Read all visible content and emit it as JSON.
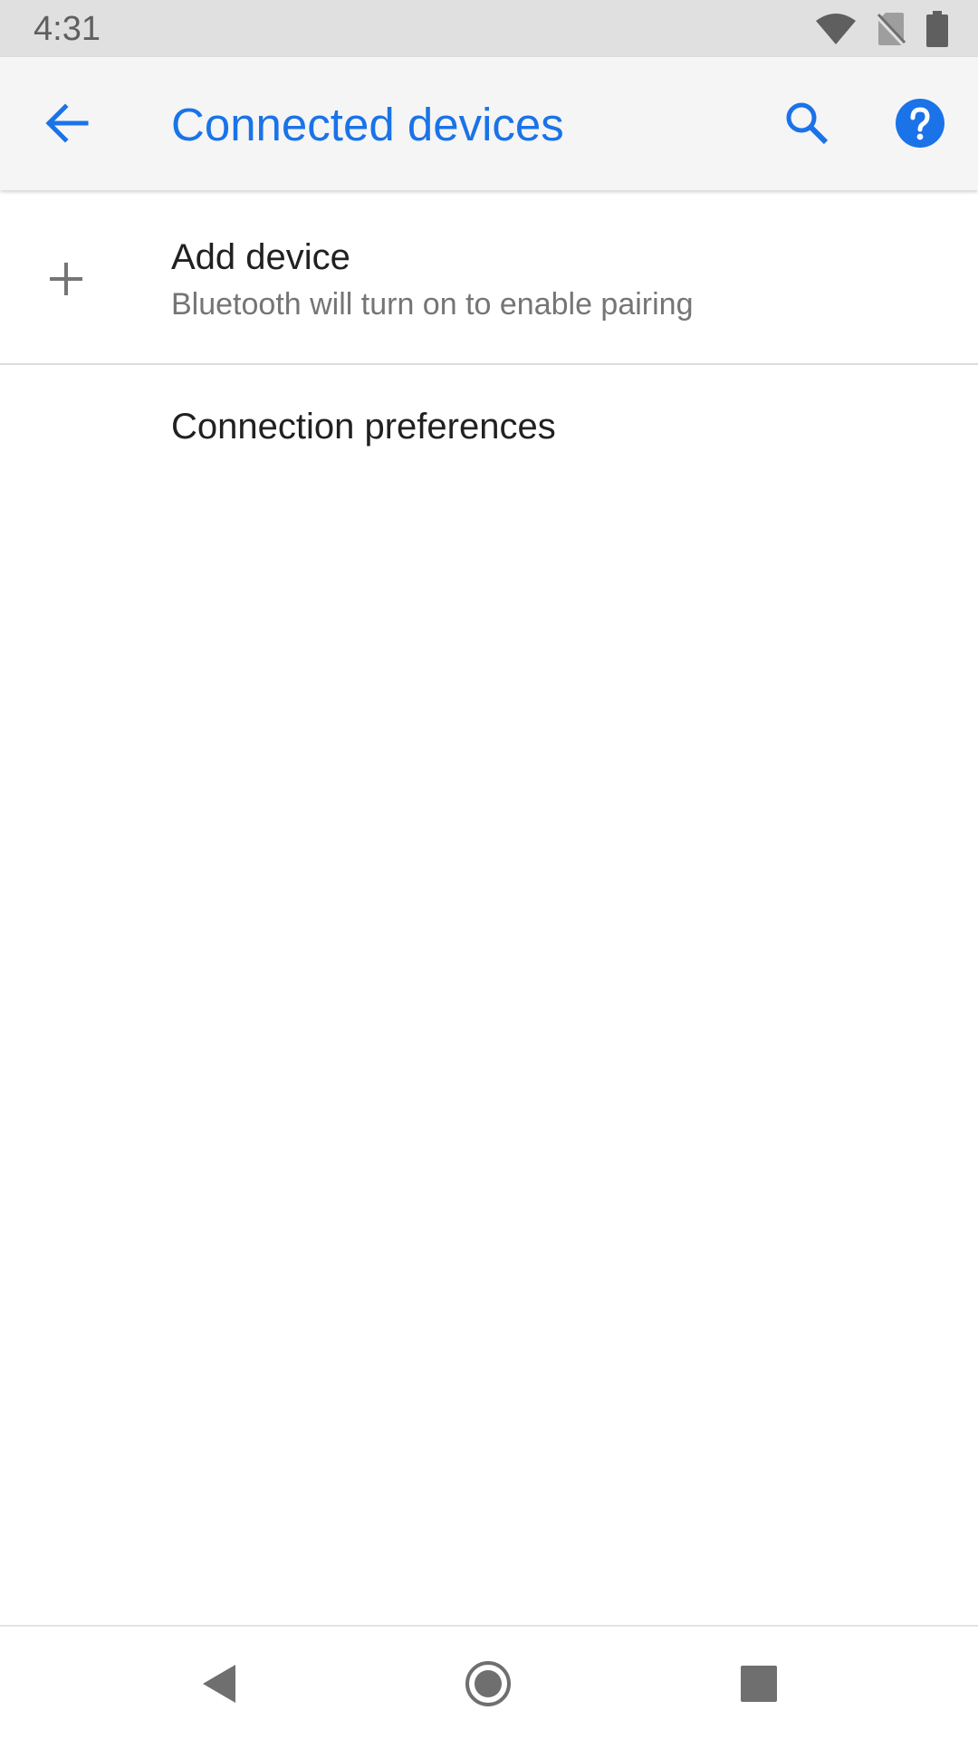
{
  "status_bar": {
    "time": "4:31",
    "icons": [
      "wifi-icon",
      "no-sim-icon",
      "battery-icon"
    ]
  },
  "app_bar": {
    "title": "Connected devices",
    "back_icon": "arrow-back-icon",
    "search_icon": "search-icon",
    "help_icon": "help-icon"
  },
  "list": {
    "add_device": {
      "icon": "plus-icon",
      "title": "Add device",
      "subtitle": "Bluetooth will turn on to enable pairing"
    },
    "connection_preferences": {
      "title": "Connection preferences"
    }
  },
  "nav_bar": {
    "buttons": [
      "nav-back-icon",
      "nav-home-icon",
      "nav-recents-icon"
    ]
  },
  "colors": {
    "accent": "#1a73e8",
    "status_bar_bg": "#e0e0e0",
    "app_bar_bg": "#f5f5f5",
    "primary_text": "#212121",
    "secondary_text": "#757575"
  }
}
